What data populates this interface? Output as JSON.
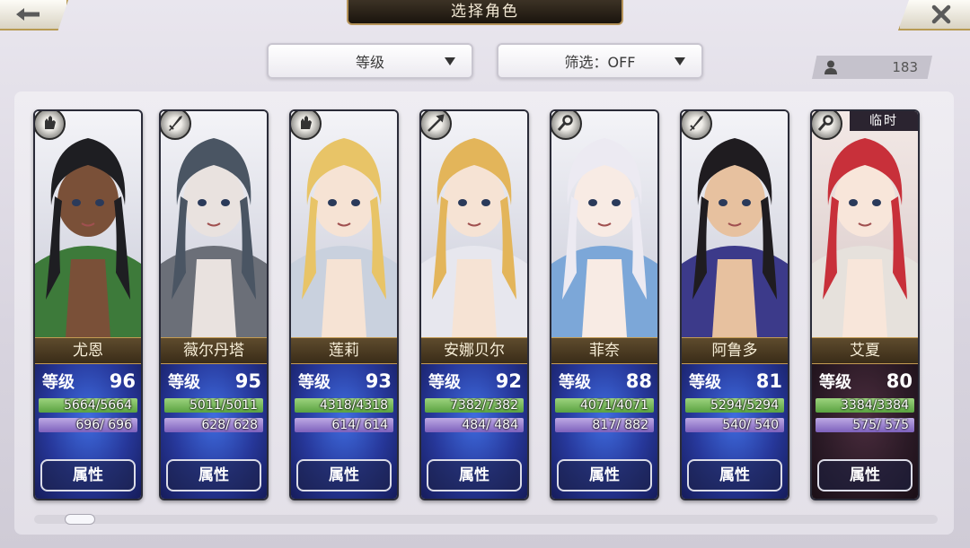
{
  "title": "选择角色",
  "sort_dropdown": {
    "label": "等级"
  },
  "filter_dropdown": {
    "label": "筛选：OFF"
  },
  "owned_count": "183",
  "level_label": "等级",
  "attr_button_label": "属性",
  "temp_tag": "临时",
  "characters": [
    {
      "name": "尤恩",
      "level": "96",
      "hp": "5664/5664",
      "mp": "696/ 696",
      "class_icon": "gauntlet-icon",
      "skin": "#7a5038",
      "hair": "#1e1e22",
      "accent": "#3d7a3a",
      "temp": false
    },
    {
      "name": "薇尔丹塔",
      "level": "95",
      "hp": "5011/5011",
      "mp": "628/ 628",
      "class_icon": "sword-icon",
      "skin": "#e9e2df",
      "hair": "#4a5563",
      "accent": "#6b6f78",
      "temp": false
    },
    {
      "name": "莲莉",
      "level": "93",
      "hp": "4318/4318",
      "mp": "614/ 614",
      "class_icon": "gauntlet-icon",
      "skin": "#f6e3d4",
      "hair": "#e8c467",
      "accent": "#c9d1de",
      "temp": false
    },
    {
      "name": "安娜贝尔",
      "level": "92",
      "hp": "7382/7382",
      "mp": "484/ 484",
      "class_icon": "spear-icon",
      "skin": "#f6e3d4",
      "hair": "#e3b55a",
      "accent": "#e7e7ee",
      "temp": false
    },
    {
      "name": "菲奈",
      "level": "88",
      "hp": "4071/4071",
      "mp": "817/ 882",
      "class_icon": "staff-icon",
      "skin": "#f8ebe4",
      "hair": "#eceaf2",
      "accent": "#7ca7d8",
      "temp": false
    },
    {
      "name": "阿鲁多",
      "level": "81",
      "hp": "5294/5294",
      "mp": "540/ 540",
      "class_icon": "sword-icon",
      "skin": "#e7c19f",
      "hair": "#1f1c20",
      "accent": "#3c3a8a",
      "temp": false
    },
    {
      "name": "艾夏",
      "level": "80",
      "hp": "3384/3384",
      "mp": "575/ 575",
      "class_icon": "staff-icon",
      "skin": "#f8e6da",
      "hair": "#c8303a",
      "accent": "#e6e1dc",
      "temp": true
    }
  ]
}
